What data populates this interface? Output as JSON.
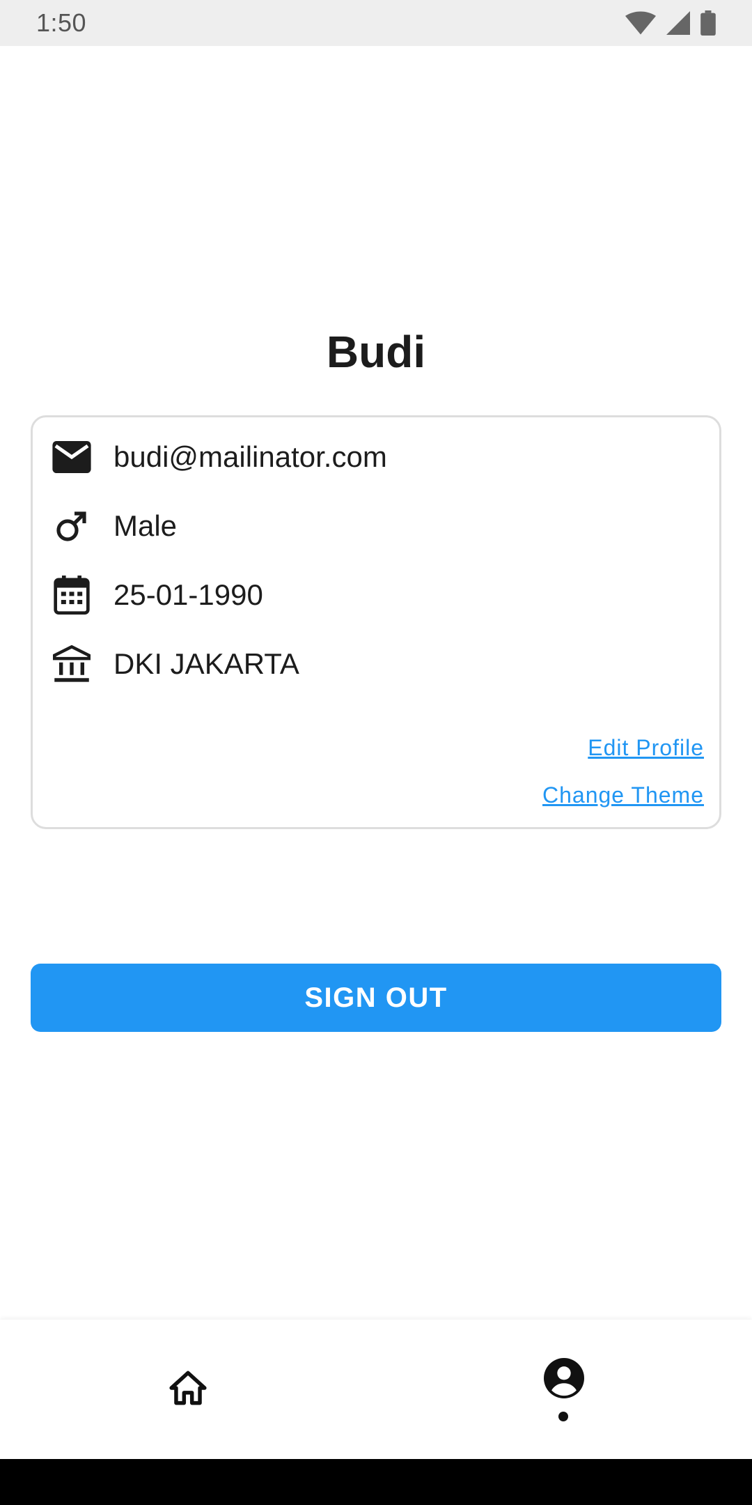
{
  "status_bar": {
    "time": "1:50",
    "icons": [
      "wifi-icon",
      "cell-signal-icon",
      "battery-icon"
    ]
  },
  "profile": {
    "name": "Budi",
    "email": "budi@mailinator.com",
    "gender": "Male",
    "date_of_birth": "25-01-1990",
    "region": "DKI JAKARTA"
  },
  "card": {
    "icons": [
      "email-icon",
      "male-icon",
      "calendar-icon",
      "institution-icon"
    ],
    "edit_profile_label": "Edit Profile",
    "change_theme_label": "Change Theme"
  },
  "actions": {
    "sign_out_label": "SIGN OUT"
  },
  "bottom_nav": {
    "items": [
      {
        "icon": "home-icon",
        "selected": false
      },
      {
        "icon": "account-circle-icon",
        "selected": true
      }
    ]
  },
  "colors": {
    "accent": "#2196f3",
    "text": "#1c1c1c",
    "card_border": "#dddddd",
    "status_bar_bg": "#eeeeee"
  }
}
